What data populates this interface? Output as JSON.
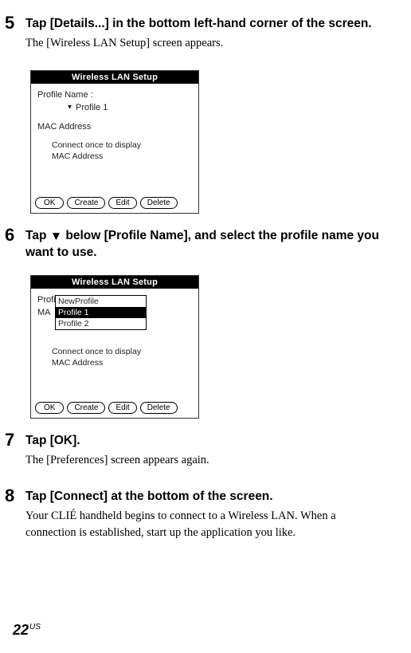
{
  "steps": {
    "s5": {
      "num": "5",
      "title": "Tap [Details...] in the bottom left-hand corner of the screen.",
      "body": "The [Wireless LAN Setup] screen appears."
    },
    "s6": {
      "num": "6",
      "title_pre": "Tap ",
      "title_post": " below [Profile Name], and select the profile name you want to use."
    },
    "s7": {
      "num": "7",
      "title": "Tap [OK].",
      "body": "The [Preferences] screen appears again."
    },
    "s8": {
      "num": "8",
      "title": "Tap [Connect] at the bottom of the screen.",
      "body": "Your CLIÉ handheld begins to connect to a Wireless LAN. When a connection is established, start up the application you like."
    }
  },
  "device": {
    "title": "Wireless LAN Setup",
    "profile_label": "Profile Name :",
    "profile_value": "Profile 1",
    "mac_label": "MAC Address",
    "mac_prefix": "MA",
    "mac_hint1": "Connect once to display",
    "mac_hint2": "MAC Address",
    "dropdown": {
      "opt0": "NewProfile",
      "opt1": "Profile 1",
      "opt2": "Profile 2"
    },
    "buttons": {
      "ok": "OK",
      "create": "Create",
      "edit": "Edit",
      "delete": "Delete"
    }
  },
  "page": {
    "num": "22",
    "suffix": "US"
  }
}
